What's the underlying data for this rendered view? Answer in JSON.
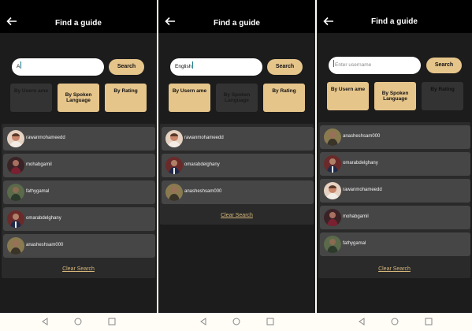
{
  "screens": [
    {
      "title": "Find a guide",
      "search": {
        "value": "A",
        "placeholder": "",
        "caret": "after",
        "button": "Search"
      },
      "filters": [
        {
          "label": "By Usern ame",
          "active": false
        },
        {
          "label": "By Spoken Language",
          "active": true
        },
        {
          "label": "By Rating",
          "active": true
        }
      ],
      "results": [
        {
          "username": "rawanmohameedd",
          "avatar": "girl-avatar"
        },
        {
          "username": "mohabgamil",
          "avatar": "man-red-avatar"
        },
        {
          "username": "fathygamal",
          "avatar": "man-green-avatar"
        },
        {
          "username": "omarabdelghany",
          "avatar": "man-suit-avatar"
        },
        {
          "username": "anasheshsam000",
          "avatar": "man-outdoor-avatar"
        }
      ],
      "clear_label": "Clear Search"
    },
    {
      "title": "Find a guide",
      "search": {
        "value": "English",
        "placeholder": "",
        "caret": "after",
        "button": "Search"
      },
      "filters": [
        {
          "label": "By Usern ame",
          "active": true
        },
        {
          "label": "By Spoken Language",
          "active": false
        },
        {
          "label": "By Rating",
          "active": true
        }
      ],
      "results": [
        {
          "username": "rawanmohameedd",
          "avatar": "girl-avatar"
        },
        {
          "username": "omarabdelghany",
          "avatar": "man-suit-avatar"
        },
        {
          "username": "anasheshsam000",
          "avatar": "man-outdoor-avatar"
        }
      ],
      "clear_label": "Clear Search"
    },
    {
      "title": "Find a guide",
      "search": {
        "value": "",
        "placeholder": "Enter username",
        "caret": "before",
        "button": "Search"
      },
      "filters": [
        {
          "label": "By Usern ame",
          "active": true
        },
        {
          "label": "By Spoken Language",
          "active": true
        },
        {
          "label": "By Rating",
          "active": false
        }
      ],
      "results": [
        {
          "username": "anasheshsam000",
          "avatar": "man-outdoor-avatar"
        },
        {
          "username": "omarabdelghany",
          "avatar": "man-suit-avatar"
        },
        {
          "username": "rawanmohameedd",
          "avatar": "girl-avatar"
        },
        {
          "username": "mohabgamil",
          "avatar": "man-red-avatar"
        },
        {
          "username": "fathygamal",
          "avatar": "man-green-avatar"
        }
      ],
      "clear_label": "Clear Search"
    }
  ],
  "colors": {
    "accent": "#e6c58b",
    "background": "#000000",
    "row": "#464646",
    "link": "#d4b57a"
  }
}
